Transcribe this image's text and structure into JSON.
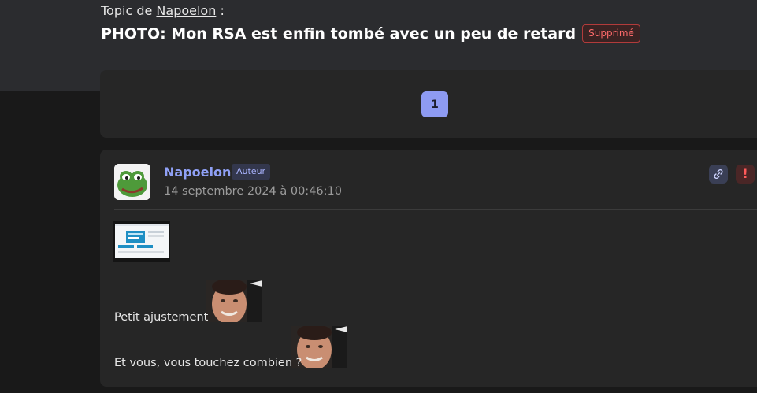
{
  "topic": {
    "prefix": "Topic de",
    "author_link": "Napoelon",
    "suffix": ":",
    "title": "PHOTO: Mon RSA est enfin tombé avec un peu de retard",
    "status_badge": "Supprimé"
  },
  "pagination": {
    "current_page": "1"
  },
  "post": {
    "author": "Napoelon",
    "author_badge": "Auteur",
    "date": "14 septembre 2024 à 00:46:10",
    "lines": [
      "Petit ajustement",
      "Et vous, vous touchez combien ?"
    ],
    "actions": {
      "link_icon": "link-icon",
      "report_icon": "exclamation-icon"
    }
  },
  "colors": {
    "accent": "#8e9bf2",
    "author_name": "#8fa0f5",
    "deleted_text": "#ff6b6b",
    "report": "#ff5a5a"
  }
}
